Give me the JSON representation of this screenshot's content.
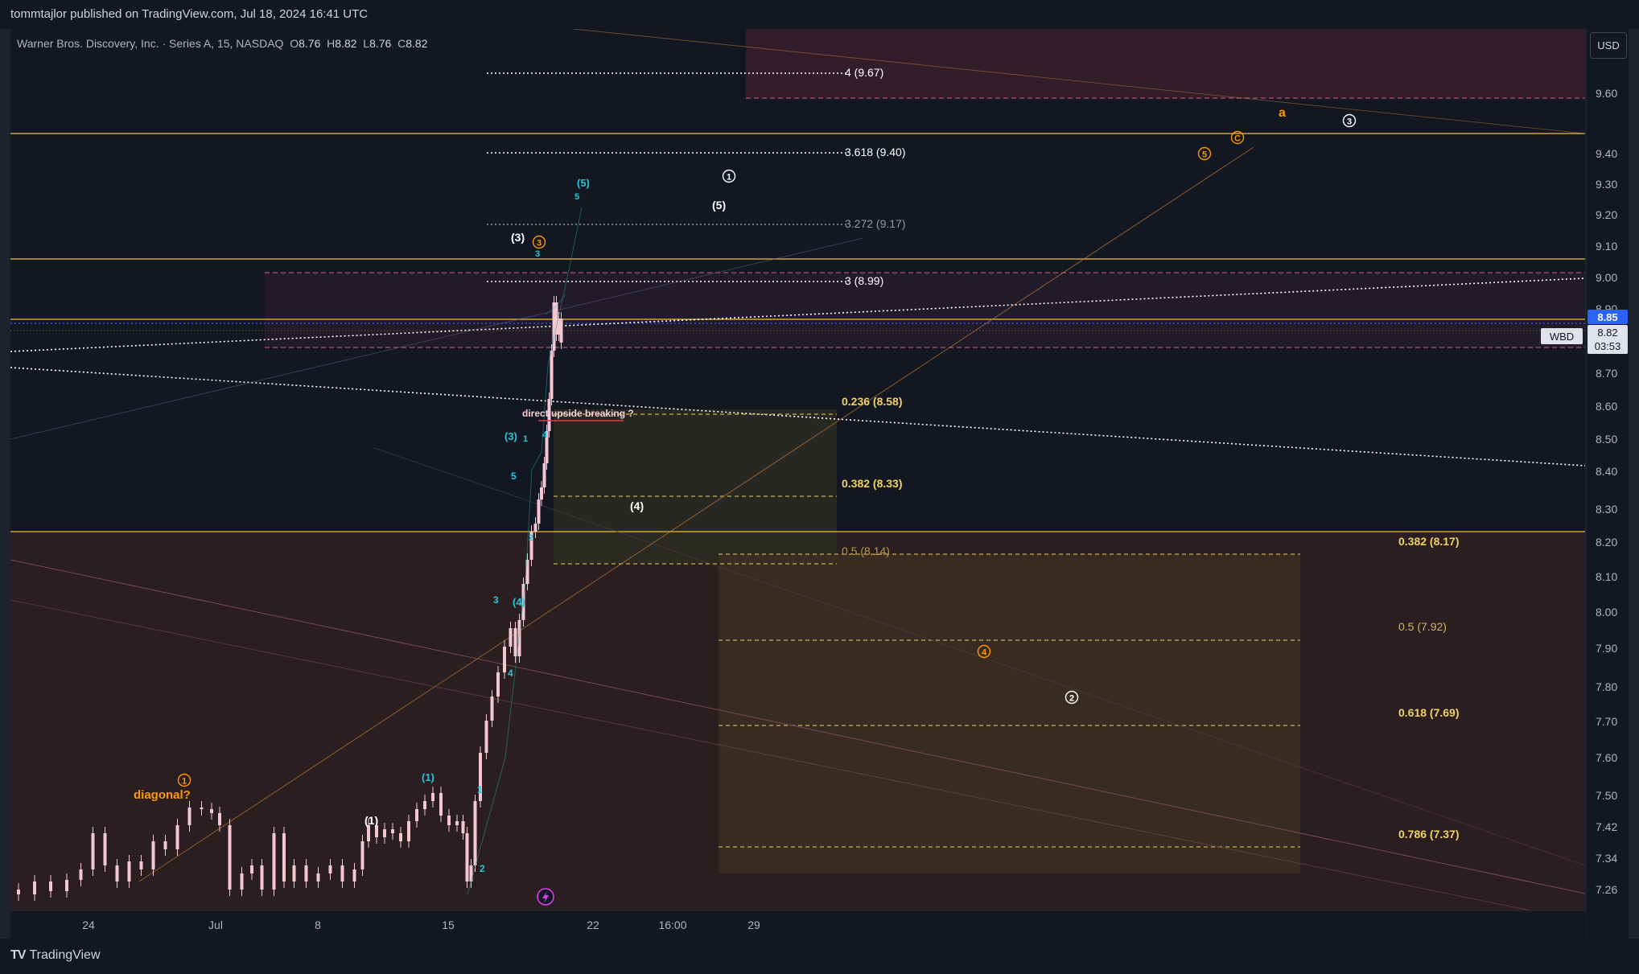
{
  "header": {
    "published_text": "tommtajlor published on TradingView.com, Jul 18, 2024 16:41 UTC"
  },
  "legend": {
    "symbol_name": "Warner Bros. Discovery, Inc. · Series A, 15, NASDAQ",
    "open_label": "O",
    "open_value": "8.76",
    "high_label": "H",
    "high_value": "8.82",
    "low_label": "L",
    "low_value": "8.76",
    "close_label": "C",
    "close_value": "8.82"
  },
  "currency_button": "USD",
  "price_axis": {
    "ticks": [
      "9.60",
      "9.40",
      "9.30",
      "9.20",
      "9.10",
      "9.00",
      "8.90",
      "8.70",
      "8.60",
      "8.50",
      "8.40",
      "8.30",
      "8.20",
      "8.10",
      "8.00",
      "7.90",
      "7.80",
      "7.70",
      "7.60",
      "7.50",
      "7.42",
      "7.34",
      "7.26"
    ],
    "last_price_badge": "8.85",
    "current_price": "8.82",
    "countdown": "03:53",
    "symbol_tag": "WBD"
  },
  "time_axis": {
    "ticks": [
      "24",
      "Jul",
      "8",
      "15",
      "22",
      "16:00",
      "29"
    ]
  },
  "fib_extension_labels": [
    "4 (9.67)",
    "3.618 (9.40)",
    "3.272 (9.17)",
    "3 (8.99)"
  ],
  "fib_retracement_1": [
    "0.236 (8.58)",
    "0.382 (8.33)",
    "0.5 (8.14)"
  ],
  "fib_retracement_2": [
    "0.382 (8.17)",
    "0.5 (7.92)",
    "0.618 (7.69)",
    "0.786 (7.37)"
  ],
  "annotations": {
    "diagonal_note": "diagonal?",
    "breakout_note": "direct upside breaking ?"
  },
  "wave_labels": {
    "white_circle_1": "1",
    "white_circle_2": "2",
    "white_circle_3": "3",
    "white_paren_1": "(1)",
    "white_paren_3": "(3)",
    "white_paren_4": "(4)",
    "white_paren_5": "(5)",
    "orange_circle_1": "1",
    "orange_circle_3": "3",
    "orange_circle_4": "4",
    "orange_circle_5": "5",
    "orange_circle_c": "C",
    "orange_a": "a",
    "cyan_paren_1": "(1)",
    "cyan_paren_3": "(3)",
    "cyan_paren_4": "(4)",
    "cyan_paren_5": "(5)",
    "cyan_1": "1",
    "cyan_2": "2",
    "cyan_3": "3",
    "cyan_4": "4",
    "cyan_5": "5",
    "cyan_minor_1": "1",
    "cyan_minor_2": "2",
    "cyan_minor_3": "3",
    "cyan_minor_4": "4",
    "cyan_minor_5": "5"
  },
  "colors": {
    "background": "#131722",
    "fib_yellow": "#f0d264",
    "wave_orange": "#ff9800",
    "wave_cyan": "#26c6da",
    "candle": "#f4c7d3",
    "last_price_blue": "#2962ff"
  },
  "footer": {
    "brand": "TradingView"
  }
}
